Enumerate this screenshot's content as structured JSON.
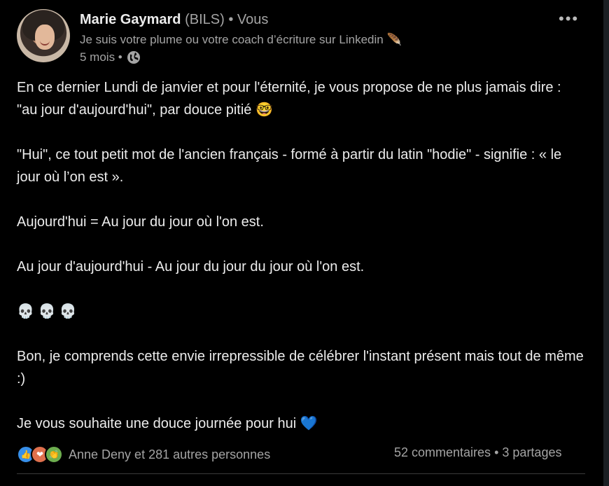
{
  "author": {
    "name": "Marie Gaymard",
    "company": "(BILS)",
    "relation": "• Vous",
    "headline": "Je suis votre plume ou votre coach d’écriture sur Linkedin 🪶",
    "time": "5 mois •",
    "visibility_icon": "globe-icon"
  },
  "post": {
    "paragraphs": [
      "En ce dernier Lundi de janvier et pour l'éternité, je vous propose de ne plus jamais dire : \"au jour d'aujourd'hui\", par douce pitié 🤓",
      "\"Hui\", ce tout petit mot de l'ancien français - formé à partir du latin \"hodie\" - signifie :  « le jour où l’on est ».",
      "Aujourd'hui = Au jour du jour où l'on est.",
      "Au jour d'aujourd'hui - Au jour du jour du jour où l'on est.",
      "💀 💀 💀",
      "Bon, je comprends cette envie irrepressible de célébrer l'instant présent mais tout de même :)",
      "Je vous souhaite une douce journée pour hui 💙"
    ]
  },
  "social": {
    "reactions_text": "Anne Deny et 281 autres personnes",
    "comments": "52 commentaires",
    "separator": "•",
    "shares": "3 partages",
    "reaction_icons": [
      "like-icon",
      "love-icon",
      "clap-icon"
    ]
  },
  "colors": {
    "background": "#000000",
    "text": "#ececec",
    "muted": "#a4a4a4",
    "like": "#378fe9",
    "love": "#df704d",
    "clap": "#6dae4f"
  }
}
